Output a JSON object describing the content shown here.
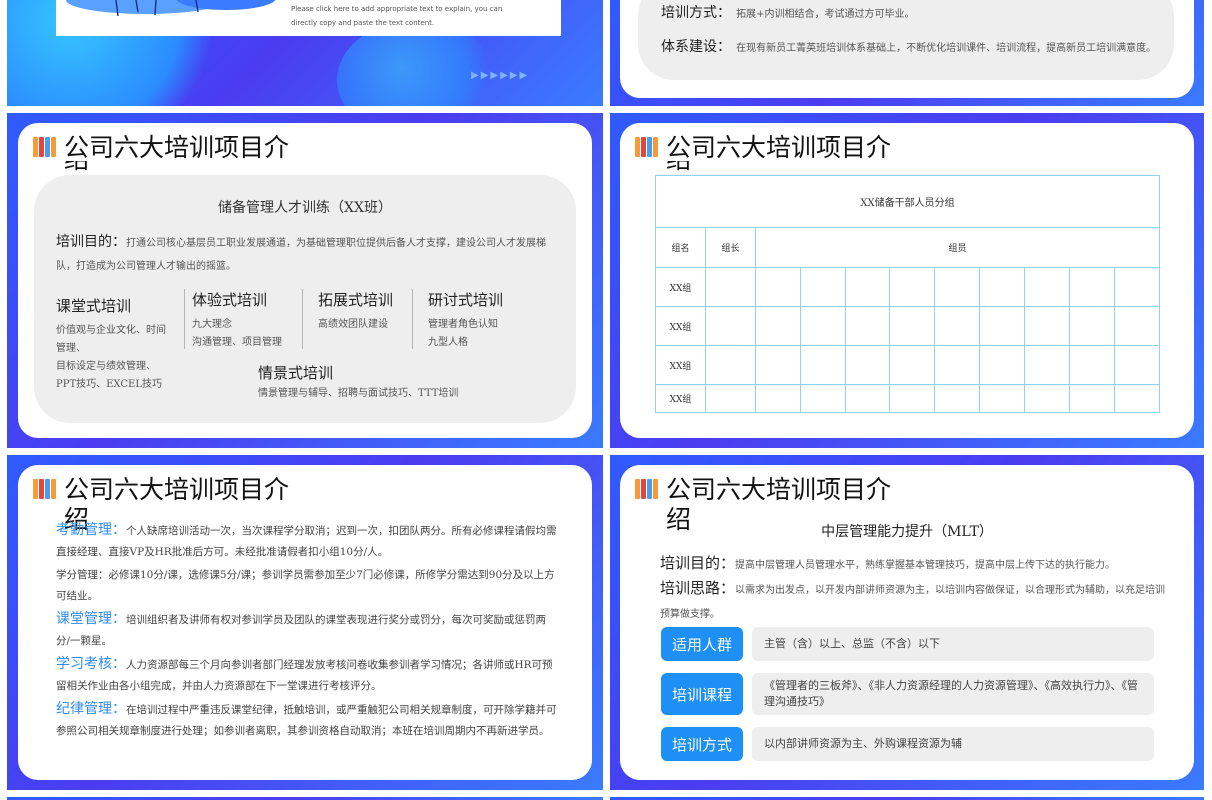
{
  "slide1": {
    "caption_line1": "Please click here to add appropriate text to explain, you can",
    "caption_line2": "directly copy and paste the text content.",
    "arrows": "▶▶▶▶▶▶"
  },
  "slide2": {
    "method_label": "培训方式：",
    "method_text": "拓展+内训相结合，考试通过方可毕业。",
    "system_label": "体系建设：",
    "system_text": "在现有新员工菁英班培训体系基础上，不断优化培训课件、培训流程，提高新员工培训满意度。"
  },
  "slide_title": "公司六大培训项目介绍",
  "slide3": {
    "heading": "储备管理人才训练（XX班）",
    "purpose_label": "培训目的：",
    "purpose_text": "打通公司核心基层员工职业发展通道，为基础管理职位提供后备人才支撑，建设公司人才发展梯队，打造成为公司管理人才输出的摇篮。",
    "types": [
      {
        "name": "课堂式培训",
        "lines": [
          "价值观与企业文化、时间",
          "管理、",
          "目标设定与绩效管理、",
          "PPT技巧、EXCEL技巧"
        ]
      },
      {
        "name": "体验式培训",
        "lines": [
          "九大理念",
          "沟通管理、项目管理"
        ]
      },
      {
        "name": "拓展式培训",
        "lines": [
          "高绩效团队建设"
        ]
      },
      {
        "name": "研讨式培训",
        "lines": [
          "管理者角色认知",
          "九型人格"
        ]
      },
      {
        "name": "情景式培训",
        "lines": [
          "情景管理与辅导、招聘与面试技巧、TTT培训"
        ]
      }
    ]
  },
  "slide4": {
    "table_title": "XX储备干部人员分组",
    "col_group": "组名",
    "col_leader": "组长",
    "col_members": "组员",
    "rows": [
      "XX组",
      "XX组",
      "XX组",
      "XX组"
    ]
  },
  "slide5": {
    "items": [
      {
        "label": "考勤管理：",
        "text": "个人缺席培训活动一次，当次课程学分取消；迟到一次，扣团队两分。所有必修课程请假均需直接经理、直接VP及HR批准后方可。未经批准请假者扣小组10分/人。"
      },
      {
        "label": "",
        "text": "学分管理：必修课10分/课，选修课5分/课；参训学员需参加至少7门必修课，所修学分需达到90分及以上方可结业。"
      },
      {
        "label": "课堂管理：",
        "text": "培训组织者及讲师有权对参训学员及团队的课堂表现进行奖分或罚分，每次可奖励或惩罚两分/一颗星。"
      },
      {
        "label": "学习考核：",
        "text": "人力资源部每三个月向参训者部门经理发放考核问卷收集参训者学习情况；各讲师或HR可预留相关作业由各小组完成，并由人力资源部在下一堂课进行考核评分。"
      },
      {
        "label": "纪律管理：",
        "text": "在培训过程中严重违反课堂纪律，抵触培训，或严重触犯公司相关规章制度，可开除学籍并可参照公司相关规章制度进行处理；如参训者离职，其参训资格自动取消；本班在培训周期内不再新进学员。"
      }
    ]
  },
  "slide6": {
    "heading": "中层管理能力提升（MLT）",
    "purpose_label": "培训目的：",
    "purpose_text": "提高中层管理人员管理水平，熟练掌握基本管理技巧，提高中层上传下达的执行能力。",
    "idea_label": "培训思路：",
    "idea_text": "以需求为出发点，以开发内部讲师资源为主，以培训内容做保证，以合理形式为辅助，以充足培训预算做支撑。",
    "rows": [
      {
        "pill": "适用人群",
        "text": "主管（含）以上、总监（不含）以下"
      },
      {
        "pill": "培训课程",
        "text": "《管理者的三板斧》、《非人力资源经理的人力资源管理》、《高效执行力》、《管理沟通技巧》"
      },
      {
        "pill": "培训方式",
        "text": "以内部讲师资源为主、外购课程资源为辅"
      }
    ]
  },
  "colors": {
    "accent": "#1e8ff5",
    "slide_bg": "#3f4cf2",
    "label_blue": "#2e8cf0"
  }
}
